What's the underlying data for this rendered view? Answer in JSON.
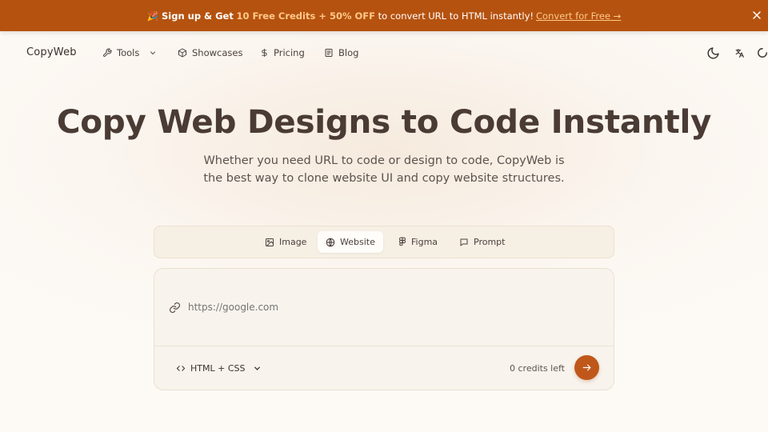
{
  "banner": {
    "emoji": "🎉",
    "lead": "Sign up & Get",
    "highlight": "10 Free Credits + 50% OFF",
    "rest": "to convert URL to HTML instantly!",
    "cta": "Convert for Free →",
    "bg_color": "#b5520f",
    "accent_color": "#ffc98a"
  },
  "nav": {
    "logo": "CopyWeb",
    "items": [
      {
        "label": "Tools",
        "icon": "wrench-icon",
        "has_dropdown": true
      },
      {
        "label": "Showcases",
        "icon": "cube-icon"
      },
      {
        "label": "Pricing",
        "icon": "dollar-icon"
      },
      {
        "label": "Blog",
        "icon": "newspaper-icon"
      }
    ],
    "right_icons": [
      "moon-icon",
      "translate-icon",
      "loading-spinner-icon"
    ]
  },
  "hero": {
    "title": "Copy Web Designs to Code Instantly",
    "subtitle_line1": "Whether you need URL to code or design to code, CopyWeb is",
    "subtitle_line2": "the best way to clone website UI and copy website structures."
  },
  "tabs": [
    {
      "label": "Image",
      "icon": "image-icon",
      "active": false
    },
    {
      "label": "Website",
      "icon": "globe-icon",
      "active": true
    },
    {
      "label": "Figma",
      "icon": "figma-icon",
      "active": false
    },
    {
      "label": "Prompt",
      "icon": "message-icon",
      "active": false
    }
  ],
  "input_card": {
    "url_placeholder": "https://google.com",
    "url_icon": "link-icon",
    "format_label": "HTML + CSS",
    "format_icon": "code-icon",
    "credits_text": "0 credits left",
    "submit_icon": "arrow-right-icon",
    "accent_color": "#c0571a"
  }
}
